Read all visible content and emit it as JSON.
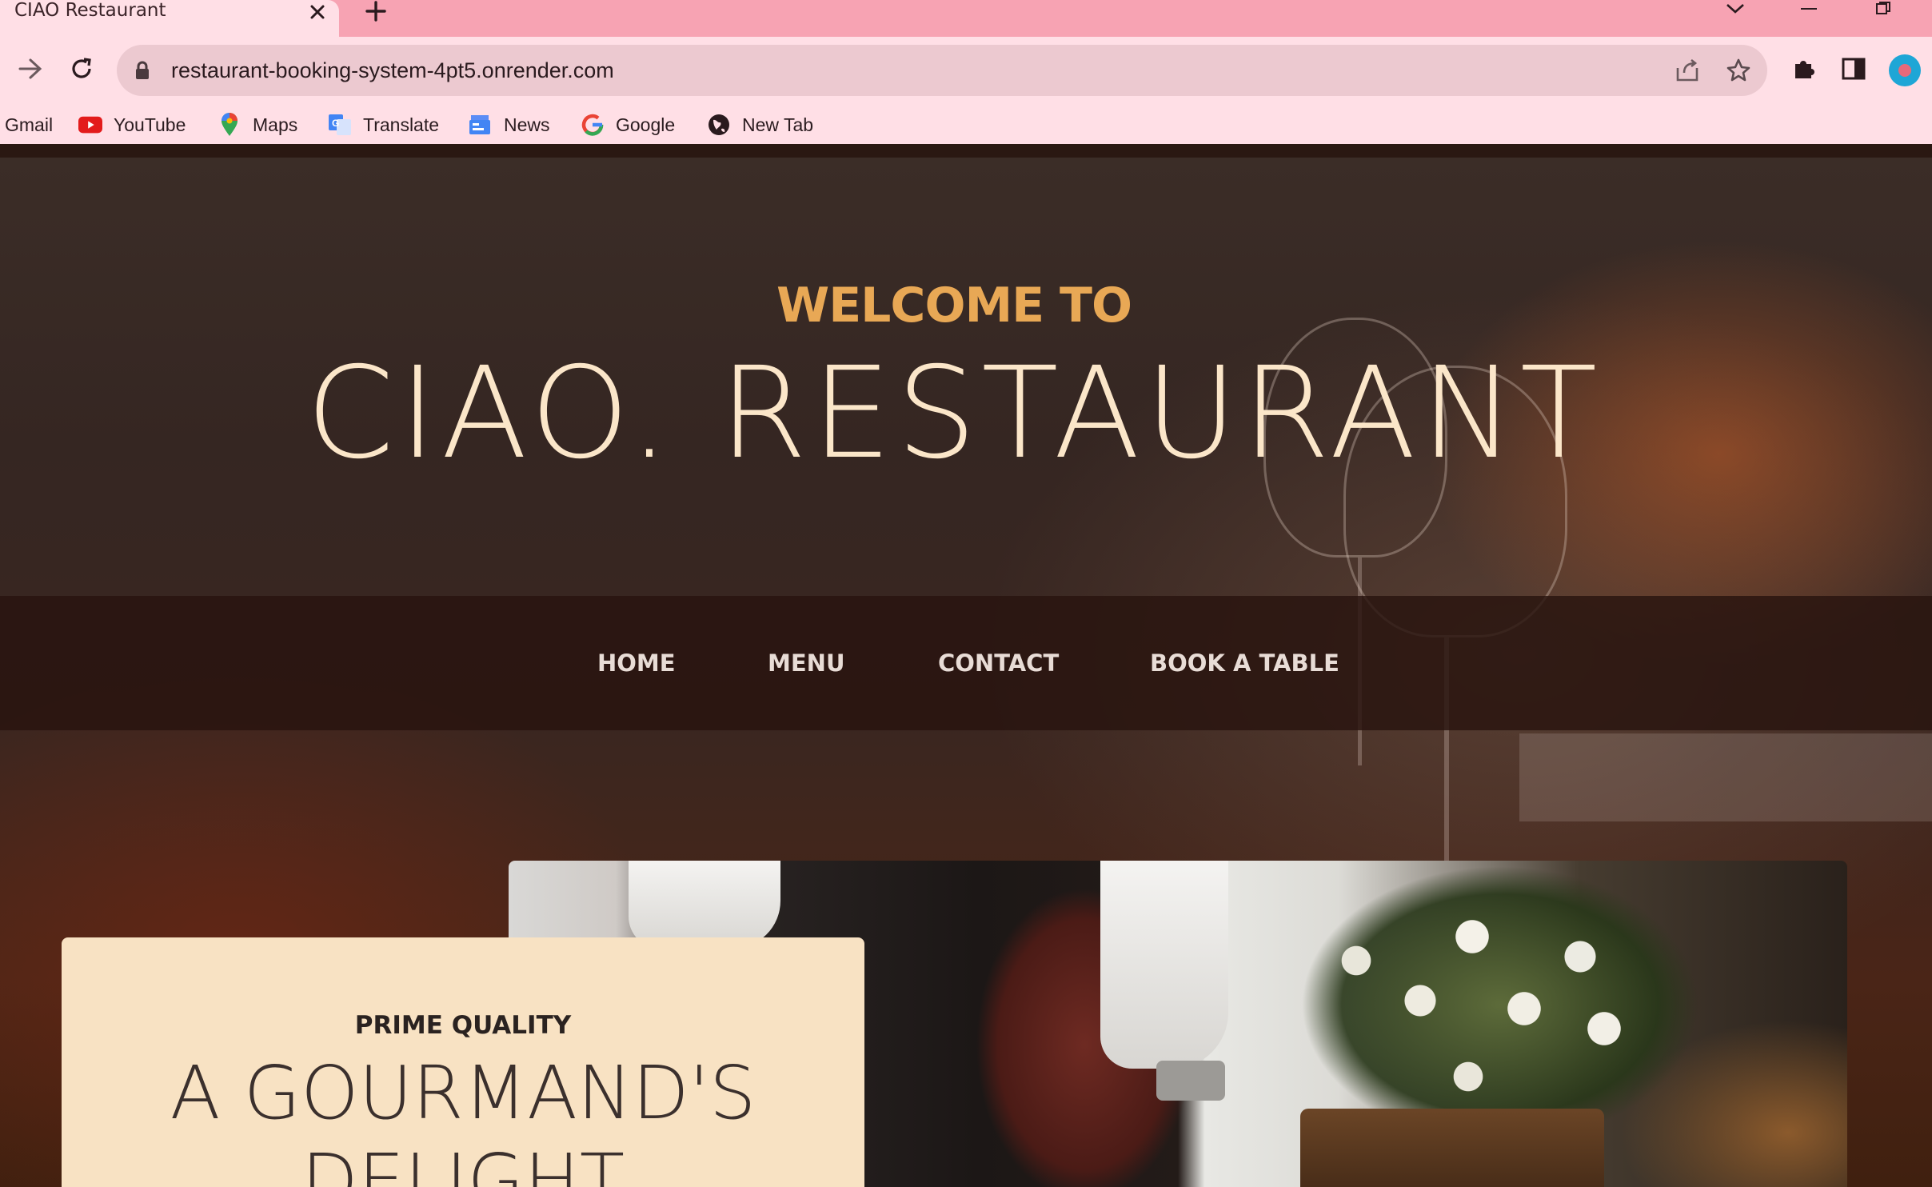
{
  "browser": {
    "tab_title": "CIAO Restaurant",
    "url": "restaurant-booking-system-4pt5.onrender.com",
    "bookmarks": [
      {
        "label": "Gmail",
        "icon": "gmail-icon"
      },
      {
        "label": "YouTube",
        "icon": "youtube-icon"
      },
      {
        "label": "Maps",
        "icon": "maps-icon"
      },
      {
        "label": "Translate",
        "icon": "translate-icon"
      },
      {
        "label": "News",
        "icon": "news-icon"
      },
      {
        "label": "Google",
        "icon": "google-icon"
      },
      {
        "label": "New Tab",
        "icon": "globe-icon"
      }
    ],
    "colors": {
      "tabbar": "#f7a3b3",
      "toolbar": "#ffdfe6",
      "omnibox": "#ecc9d0"
    }
  },
  "hero": {
    "kicker": "WELCOME TO",
    "title": "CIAO. RESTAURANT",
    "colors": {
      "kicker": "#e8a855",
      "title": "#fbe6c9"
    }
  },
  "nav": {
    "items": [
      "HOME",
      "MENU",
      "CONTACT",
      "BOOK A TABLE"
    ]
  },
  "feature": {
    "kicker": "PRIME QUALITY",
    "title": "A GOURMAND'S DELIGHT",
    "card_color": "#f8e2c3"
  }
}
